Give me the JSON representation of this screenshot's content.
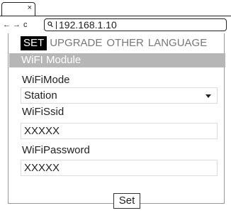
{
  "browser": {
    "tab_close": "×",
    "nav_back": "←",
    "nav_forward": "→",
    "nav_reload": "c",
    "address_icon": "search-icon",
    "url": "192.168.1.10"
  },
  "nav": {
    "tabs": [
      {
        "label": "SET",
        "active": true
      },
      {
        "label": "UPGRADE",
        "active": false
      },
      {
        "label": "OTHER",
        "active": false
      },
      {
        "label": "LANGUAGE",
        "active": false
      }
    ]
  },
  "module": {
    "title": "WiFI Module",
    "wifi_mode_label": "WiFiMode",
    "wifi_mode_value": "Station",
    "ssid_label": "WiFiSsid",
    "ssid_value": "XXXXX",
    "password_label": "WiFiPassword",
    "password_value": "XXXXX",
    "submit_label": "Set"
  },
  "colors": {
    "active_tab_bg": "#000000",
    "inactive_tab_text": "#777777",
    "header_bg": "#b6b6b6"
  }
}
